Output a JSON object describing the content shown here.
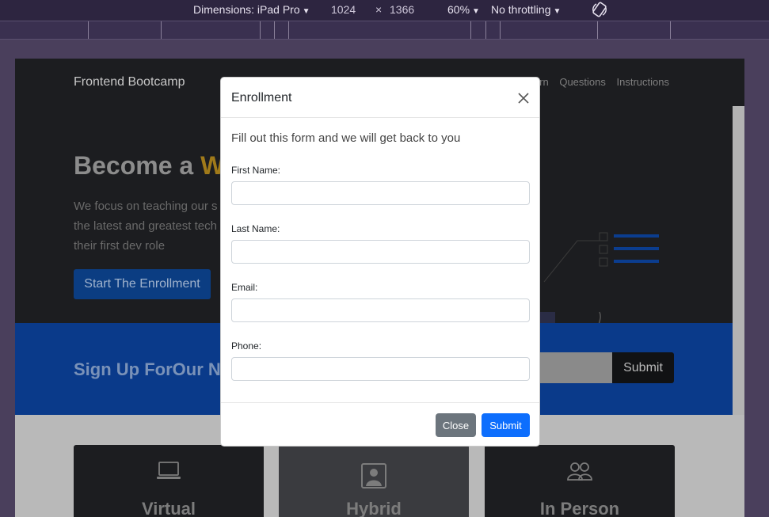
{
  "devtools": {
    "dimensions_label": "Dimensions: iPad Pro",
    "width": "1024",
    "times": "×",
    "height": "1366",
    "zoom": "60%",
    "throttling": "No throttling"
  },
  "site": {
    "brand": "Frontend Bootcamp",
    "nav": [
      "rn",
      "Questions",
      "Instructions"
    ],
    "hero_title_prefix": "Become a ",
    "hero_title_accent": "We",
    "hero_lines": [
      "We focus on teaching our s",
      "the latest and greatest tech",
      "their first dev role"
    ],
    "hero_button": "Start The Enrollment",
    "signup_title": "Sign Up ForOur Ne",
    "signup_button": "Submit",
    "cards": [
      {
        "title": "Virtual",
        "icon": "laptop-icon"
      },
      {
        "title": "Hybrid",
        "icon": "person-badge-icon"
      },
      {
        "title": "In Person",
        "icon": "people-icon"
      }
    ]
  },
  "modal": {
    "title": "Enrollment",
    "intro": "Fill out this form and we will get back to you",
    "fields": [
      {
        "label": "First Name:",
        "value": ""
      },
      {
        "label": "Last Name:",
        "value": ""
      },
      {
        "label": "Email:",
        "value": ""
      },
      {
        "label": "Phone:",
        "value": ""
      }
    ],
    "close_label": "Close",
    "submit_label": "Submit"
  },
  "colors": {
    "primary": "#0d6efd",
    "secondary": "#6c757d",
    "accent": "#ffc107"
  }
}
